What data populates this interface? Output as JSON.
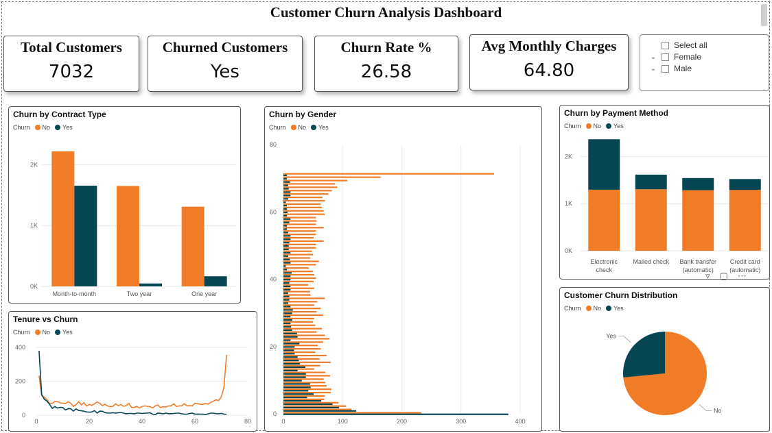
{
  "title": "Customer Churn Analysis Dashboard",
  "colors": {
    "no": "#f07c27",
    "yes": "#064652"
  },
  "kpis": [
    {
      "label": "Total Customers",
      "value": "7032"
    },
    {
      "label": "Churned Customers",
      "value": "Yes"
    },
    {
      "label": "Churn Rate %",
      "value": "26.58"
    },
    {
      "label": "Avg Monthly Charges",
      "value": "64.80"
    }
  ],
  "slicer": {
    "items": [
      {
        "label": "Select all",
        "expandable": false
      },
      {
        "label": "Female",
        "expandable": true
      },
      {
        "label": "Male",
        "expandable": true
      }
    ]
  },
  "legend": {
    "title": "Churn",
    "no": "No",
    "yes": "Yes"
  },
  "chart_data": [
    {
      "id": "contract",
      "type": "bar",
      "title": "Churn by Contract Type",
      "categories": [
        "Month-to-month",
        "Two year",
        "One year"
      ],
      "series": [
        {
          "name": "No",
          "values": [
            2220,
            1650,
            1310
          ]
        },
        {
          "name": "Yes",
          "values": [
            1655,
            48,
            166
          ]
        }
      ],
      "yticks": [
        "0K",
        "1K",
        "2K"
      ],
      "ylim": [
        0,
        2500
      ]
    },
    {
      "id": "tenure",
      "type": "line",
      "title": "Tenure vs Churn",
      "xticks": [
        "0",
        "20",
        "40",
        "60",
        "80"
      ],
      "yticks": [
        "0",
        "200",
        "400"
      ],
      "xlim": [
        0,
        80
      ],
      "ylim": [
        0,
        400
      ],
      "series": [
        {
          "name": "No",
          "points": [
            [
              1,
              233
            ],
            [
              2,
              115
            ],
            [
              3,
              106
            ],
            [
              4,
              93
            ],
            [
              5,
              69
            ],
            [
              6,
              70
            ],
            [
              7,
              80
            ],
            [
              8,
              81
            ],
            [
              9,
              73
            ],
            [
              10,
              71
            ],
            [
              11,
              68
            ],
            [
              12,
              79
            ],
            [
              13,
              71
            ],
            [
              14,
              52
            ],
            [
              15,
              62
            ],
            [
              16,
              80
            ],
            [
              17,
              61
            ],
            [
              18,
              73
            ],
            [
              19,
              54
            ],
            [
              20,
              63
            ],
            [
              21,
              58
            ],
            [
              22,
              67
            ],
            [
              23,
              78
            ],
            [
              24,
              70
            ],
            [
              25,
              56
            ],
            [
              26,
              65
            ],
            [
              27,
              54
            ],
            [
              28,
              50
            ],
            [
              29,
              52
            ],
            [
              30,
              67
            ],
            [
              31,
              56
            ],
            [
              32,
              63
            ],
            [
              33,
              52
            ],
            [
              34,
              57
            ],
            [
              35,
              70
            ],
            [
              36,
              46
            ],
            [
              37,
              45
            ],
            [
              38,
              52
            ],
            [
              39,
              42
            ],
            [
              40,
              51
            ],
            [
              41,
              55
            ],
            [
              42,
              52
            ],
            [
              43,
              50
            ],
            [
              44,
              43
            ],
            [
              45,
              55
            ],
            [
              46,
              60
            ],
            [
              47,
              45
            ],
            [
              48,
              50
            ],
            [
              49,
              48
            ],
            [
              50,
              55
            ],
            [
              51,
              55
            ],
            [
              52,
              68
            ],
            [
              53,
              51
            ],
            [
              54,
              55
            ],
            [
              55,
              55
            ],
            [
              56,
              68
            ],
            [
              57,
              55
            ],
            [
              58,
              56
            ],
            [
              59,
              55
            ],
            [
              60,
              70
            ],
            [
              61,
              68
            ],
            [
              62,
              65
            ],
            [
              63,
              63
            ],
            [
              64,
              70
            ],
            [
              65,
              66
            ],
            [
              66,
              76
            ],
            [
              67,
              82
            ],
            [
              68,
              91
            ],
            [
              69,
              87
            ],
            [
              70,
              108
            ],
            [
              71,
              164
            ],
            [
              72,
              356
            ]
          ]
        },
        {
          "name": "Yes",
          "points": [
            [
              1,
              380
            ],
            [
              2,
              123
            ],
            [
              3,
              94
            ],
            [
              4,
              83
            ],
            [
              5,
              64
            ],
            [
              6,
              40
            ],
            [
              7,
              51
            ],
            [
              8,
              42
            ],
            [
              9,
              46
            ],
            [
              10,
              45
            ],
            [
              11,
              31
            ],
            [
              12,
              38
            ],
            [
              13,
              38
            ],
            [
              14,
              24
            ],
            [
              15,
              37
            ],
            [
              16,
              28
            ],
            [
              17,
              26
            ],
            [
              18,
              24
            ],
            [
              19,
              19
            ],
            [
              20,
              18
            ],
            [
              21,
              19
            ],
            [
              22,
              27
            ],
            [
              23,
              12
            ],
            [
              24,
              24
            ],
            [
              25,
              23
            ],
            [
              26,
              15
            ],
            [
              27,
              13
            ],
            [
              28,
              12
            ],
            [
              29,
              15
            ],
            [
              30,
              12
            ],
            [
              31,
              15
            ],
            [
              32,
              16
            ],
            [
              33,
              12
            ],
            [
              34,
              8
            ],
            [
              35,
              10
            ],
            [
              36,
              10
            ],
            [
              37,
              8
            ],
            [
              38,
              12
            ],
            [
              39,
              12
            ],
            [
              40,
              10
            ],
            [
              41,
              12
            ],
            [
              42,
              12
            ],
            [
              43,
              14
            ],
            [
              44,
              6
            ],
            [
              45,
              4
            ],
            [
              46,
              12
            ],
            [
              47,
              11
            ],
            [
              48,
              8
            ],
            [
              49,
              12
            ],
            [
              50,
              9
            ],
            [
              51,
              9
            ],
            [
              52,
              10
            ],
            [
              53,
              12
            ],
            [
              54,
              12
            ],
            [
              55,
              8
            ],
            [
              56,
              6
            ],
            [
              57,
              6
            ],
            [
              58,
              10
            ],
            [
              59,
              12
            ],
            [
              60,
              6
            ],
            [
              61,
              7
            ],
            [
              62,
              6
            ],
            [
              63,
              6
            ],
            [
              64,
              4
            ],
            [
              65,
              8
            ],
            [
              66,
              12
            ],
            [
              67,
              12
            ],
            [
              68,
              9
            ],
            [
              69,
              8
            ],
            [
              70,
              11
            ],
            [
              71,
              6
            ],
            [
              72,
              6
            ]
          ]
        }
      ]
    },
    {
      "id": "gender",
      "type": "bar",
      "title": "Churn by Gender",
      "xticks": [
        "0",
        "100",
        "200",
        "300",
        "400"
      ],
      "yticks": [
        "0",
        "20",
        "40",
        "60",
        "80"
      ],
      "xlim": [
        0,
        400
      ],
      "ylim": [
        0,
        80
      ],
      "series": [
        {
          "name": "No",
          "values": [
            233,
            115,
            106,
            93,
            69,
            70,
            80,
            81,
            73,
            71,
            68,
            79,
            71,
            52,
            62,
            80,
            61,
            73,
            54,
            63,
            58,
            67,
            78,
            70,
            56,
            65,
            54,
            50,
            52,
            67,
            56,
            63,
            52,
            57,
            70,
            46,
            45,
            52,
            42,
            51,
            55,
            52,
            50,
            43,
            55,
            60,
            45,
            50,
            48,
            55,
            55,
            68,
            51,
            55,
            55,
            68,
            55,
            56,
            55,
            70,
            68,
            65,
            63,
            70,
            66,
            76,
            82,
            91,
            87,
            108,
            164,
            356
          ]
        },
        {
          "name": "Yes",
          "values": [
            380,
            123,
            94,
            83,
            64,
            40,
            51,
            42,
            46,
            45,
            31,
            38,
            38,
            24,
            37,
            28,
            26,
            24,
            19,
            18,
            19,
            27,
            12,
            24,
            23,
            15,
            13,
            12,
            15,
            12,
            15,
            16,
            12,
            8,
            10,
            10,
            8,
            12,
            12,
            10,
            12,
            12,
            14,
            6,
            4,
            12,
            11,
            8,
            12,
            9,
            9,
            10,
            12,
            12,
            8,
            6,
            6,
            10,
            12,
            6,
            7,
            6,
            6,
            4,
            8,
            12,
            12,
            9,
            8,
            11,
            6,
            6
          ]
        }
      ]
    },
    {
      "id": "payment",
      "type": "bar",
      "title": "Churn by Payment Method",
      "categories": [
        "Electronic check",
        "Mailed check",
        "Bank transfer (automatic)",
        "Credit card (automatic)"
      ],
      "category_lines": [
        [
          "Electronic",
          "check"
        ],
        [
          "Mailed check"
        ],
        [
          "Bank transfer",
          "(automatic)"
        ],
        [
          "Credit card",
          "(automatic)"
        ]
      ],
      "series": [
        {
          "name": "No",
          "values": [
            1295,
            1305,
            1285,
            1290
          ]
        },
        {
          "name": "Yes",
          "values": [
            1070,
            310,
            258,
            232
          ]
        }
      ],
      "yticks": [
        "0K",
        "1K",
        "2K"
      ],
      "ylim": [
        0,
        2500
      ]
    },
    {
      "id": "distribution",
      "type": "pie",
      "title": "Customer Churn Distribution",
      "slices": [
        {
          "name": "No",
          "value": 73.42
        },
        {
          "name": "Yes",
          "value": 26.58
        }
      ]
    }
  ]
}
